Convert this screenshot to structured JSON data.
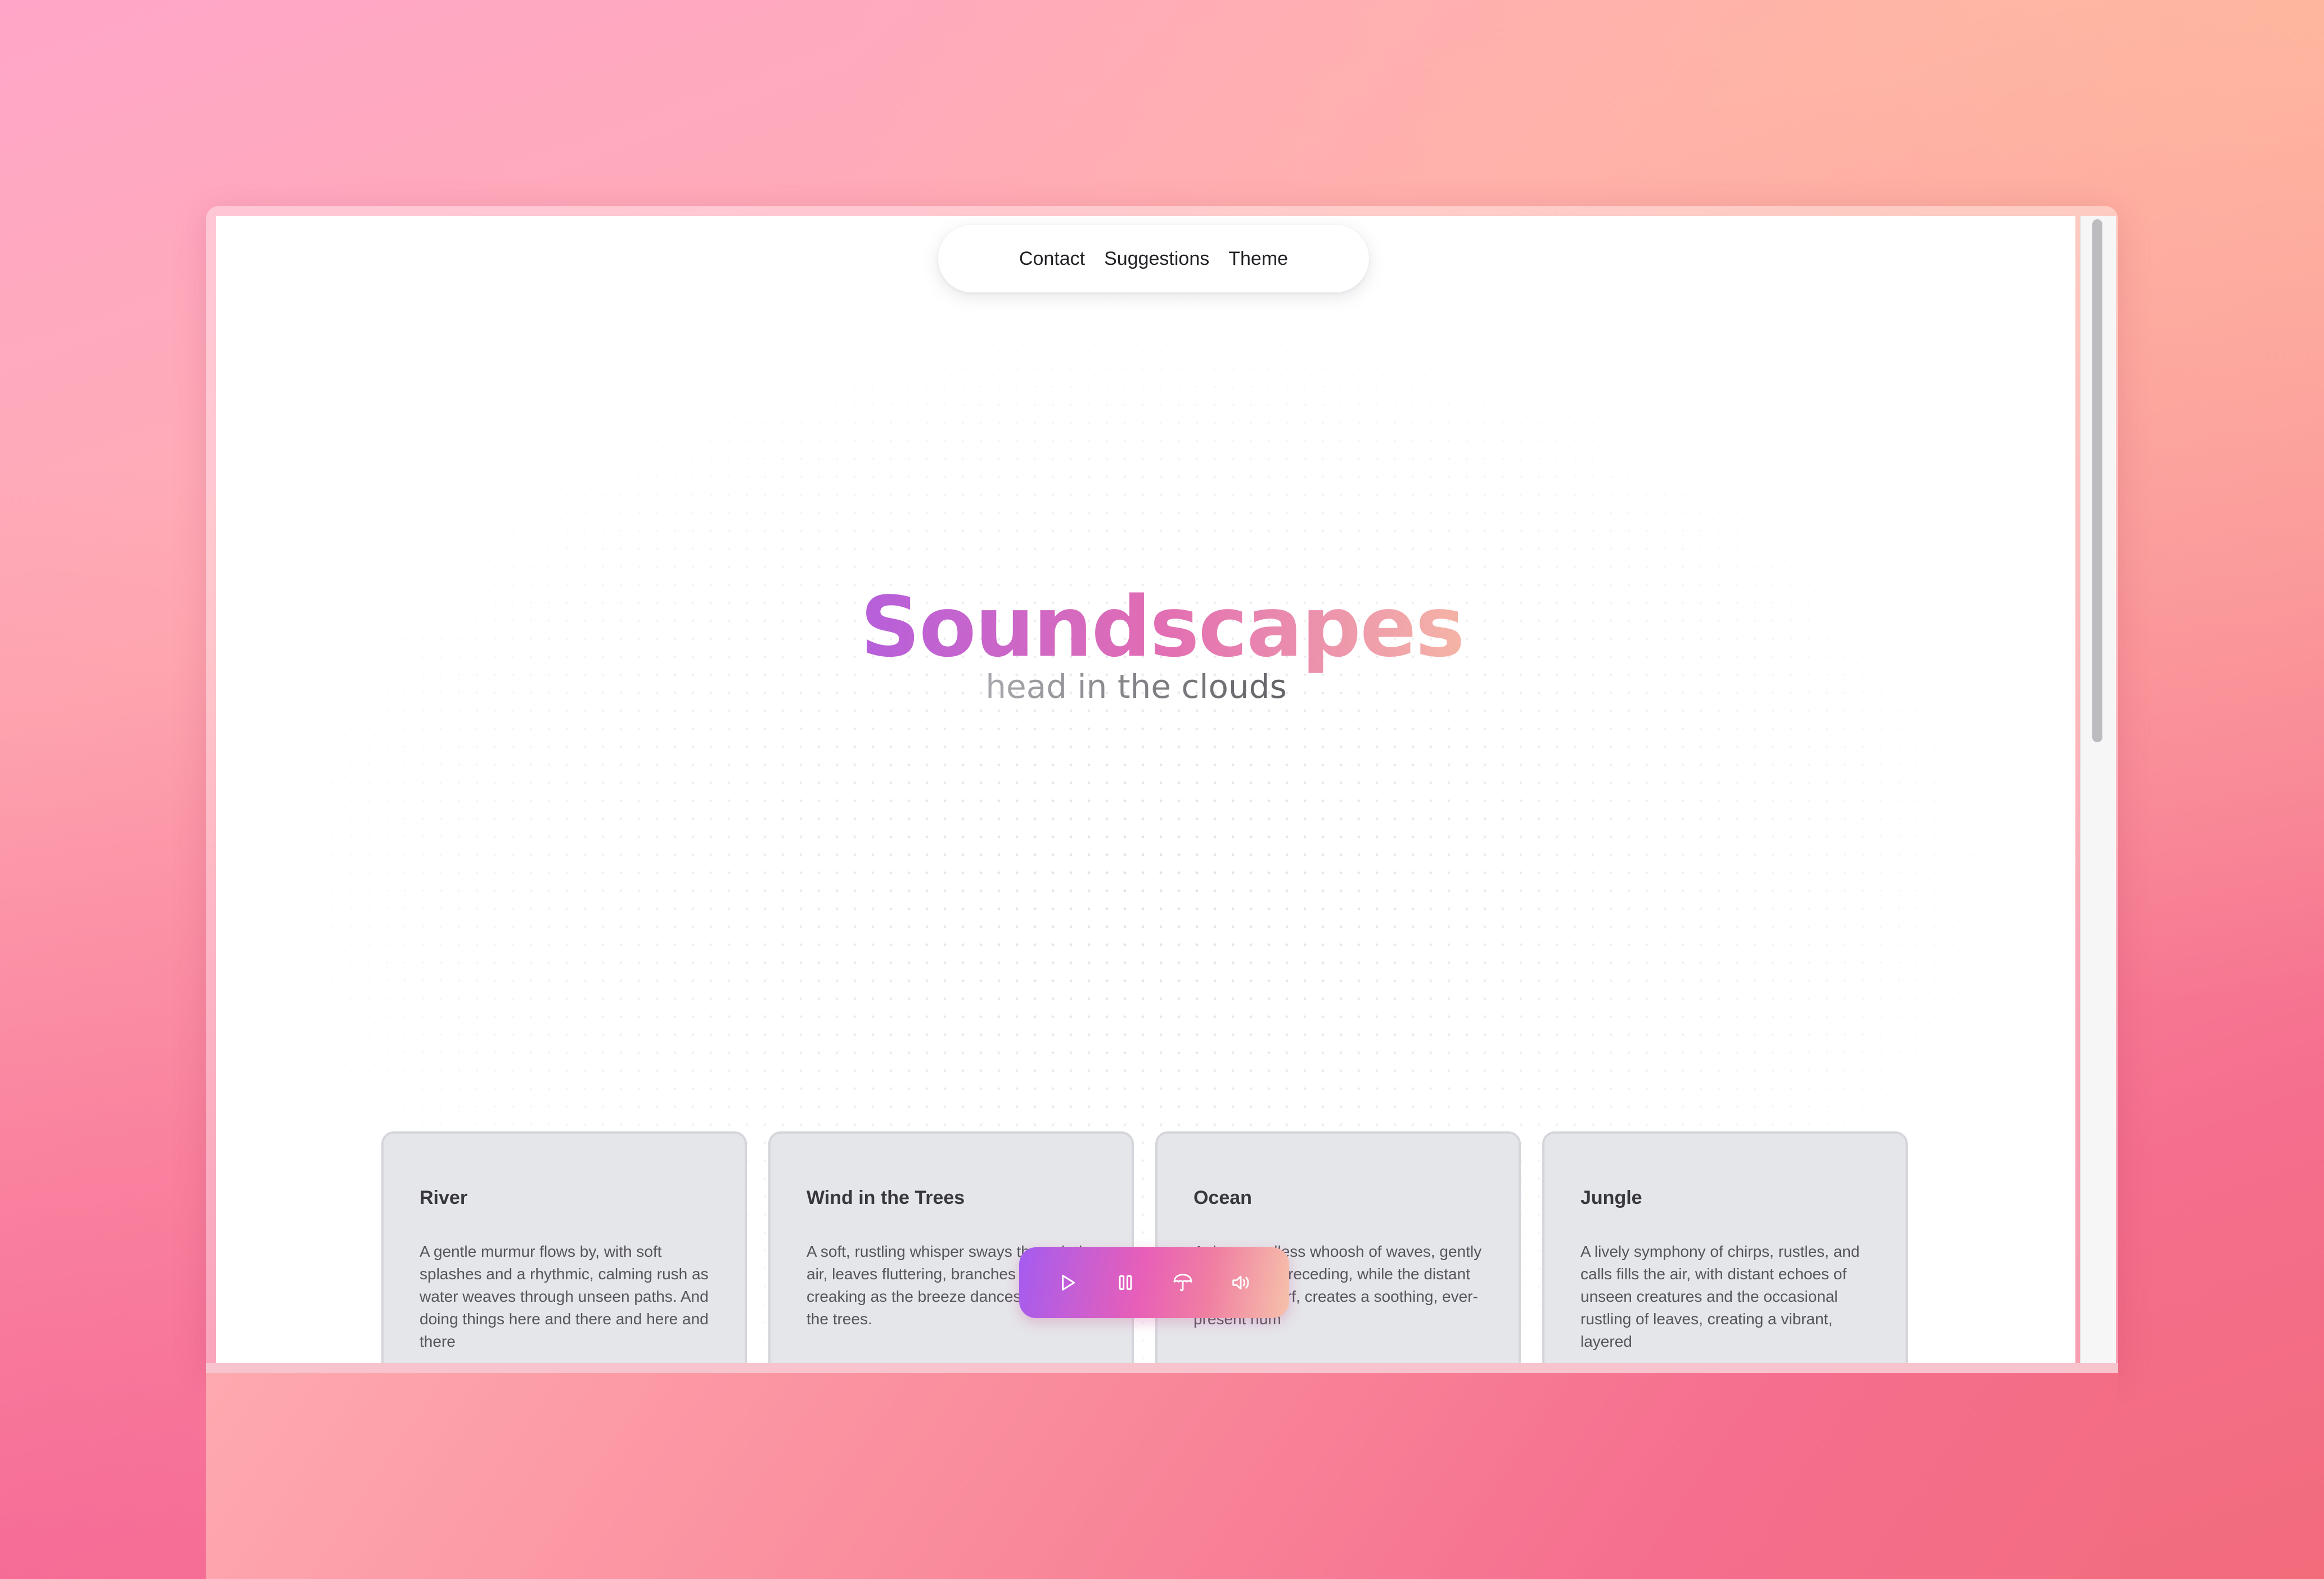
{
  "nav": {
    "items": [
      {
        "label": "Contact"
      },
      {
        "label": "Suggestions"
      },
      {
        "label": "Theme"
      }
    ]
  },
  "hero": {
    "title": "Soundscapes",
    "subtitle": "head in the clouds",
    "title_gradient": [
      "#b65fdb",
      "#e26eb3",
      "#f5b4a6"
    ]
  },
  "cards": [
    {
      "title": "River",
      "description": "A gentle murmur flows by, with soft splashes and a rhythmic, calming rush as water weaves through unseen paths. And doing things here and there and here and there"
    },
    {
      "title": "Wind in the Trees",
      "description": "A soft, rustling whisper sways through the air, leaves fluttering, branches gently creaking as the breeze dances through the trees."
    },
    {
      "title": "Ocean",
      "description": "A deep, endless whoosh of waves, gently crashing and receding, while the distant roar of the surf, creates a soothing, ever-present hum"
    },
    {
      "title": "Jungle",
      "description": "A lively symphony of chirps, rustles, and calls fills the air, with distant echoes of unseen creatures and the occasional rustling of leaves, creating a vibrant, layered"
    }
  ],
  "player": {
    "controls": [
      {
        "icon": "play-icon"
      },
      {
        "icon": "pause-icon"
      },
      {
        "icon": "umbrella-icon"
      },
      {
        "icon": "volume-icon"
      }
    ],
    "gradient": [
      "#a45cf0",
      "#e75fb8",
      "#f6c2aa"
    ]
  }
}
